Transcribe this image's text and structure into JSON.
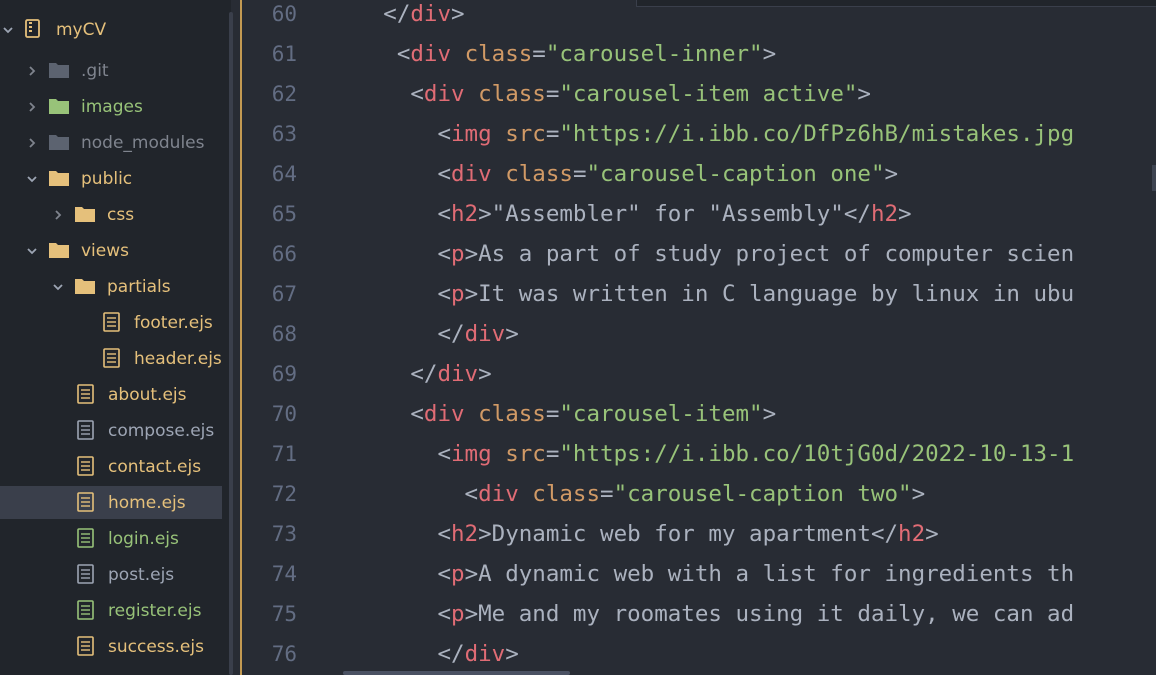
{
  "sidebar": {
    "root": {
      "label": "myCV",
      "icon": "repo-icon"
    },
    "items": [
      {
        "label": ".git",
        "kind": "folder",
        "expanded": false,
        "color": "#7f848e",
        "folder_color": "#5c6370"
      },
      {
        "label": "images",
        "kind": "folder",
        "expanded": false,
        "color": "#98c379",
        "folder_color": "#98c379"
      },
      {
        "label": "node_modules",
        "kind": "folder",
        "expanded": false,
        "color": "#7f848e",
        "folder_color": "#5c6370"
      },
      {
        "label": "public",
        "kind": "folder",
        "expanded": true,
        "color": "#e5c07b",
        "folder_color": "#e5c07b"
      },
      {
        "label": "css",
        "kind": "folder",
        "expanded": false,
        "color": "#e5c07b",
        "folder_color": "#e5c07b"
      },
      {
        "label": "views",
        "kind": "folder",
        "expanded": true,
        "color": "#e5c07b",
        "folder_color": "#e5c07b"
      },
      {
        "label": "partials",
        "kind": "folder",
        "expanded": true,
        "color": "#e5c07b",
        "folder_color": "#e5c07b"
      },
      {
        "label": "footer.ejs",
        "kind": "file",
        "color": "#e5c07b"
      },
      {
        "label": "header.ejs",
        "kind": "file",
        "color": "#e5c07b"
      },
      {
        "label": "about.ejs",
        "kind": "file",
        "color": "#e5c07b"
      },
      {
        "label": "compose.ejs",
        "kind": "file",
        "color": "#9da5b4"
      },
      {
        "label": "contact.ejs",
        "kind": "file",
        "color": "#e5c07b"
      },
      {
        "label": "home.ejs",
        "kind": "file",
        "color": "#e5c07b",
        "selected": true
      },
      {
        "label": "login.ejs",
        "kind": "file",
        "color": "#98c379"
      },
      {
        "label": "post.ejs",
        "kind": "file",
        "color": "#9da5b4"
      },
      {
        "label": "register.ejs",
        "kind": "file",
        "color": "#98c379"
      },
      {
        "label": "success.ejs",
        "kind": "file",
        "color": "#e5c07b"
      }
    ]
  },
  "editor": {
    "colors": {
      "punct": "#abb2bf",
      "tag": "#e06c75",
      "attr": "#d19a66",
      "string": "#98c379",
      "text": "#abb2bf",
      "gutter_modified": "#c39a52"
    },
    "lines": [
      {
        "n": "60",
        "tokens": [
          [
            "p",
            "      </"
          ],
          [
            "tag",
            "div"
          ],
          [
            "p",
            ">"
          ]
        ]
      },
      {
        "n": "61",
        "tokens": [
          [
            "p",
            "       <"
          ],
          [
            "tag",
            "div"
          ],
          [
            "p",
            " "
          ],
          [
            "attr",
            "class"
          ],
          [
            "p",
            "="
          ],
          [
            "str",
            "\"carousel-inner\""
          ],
          [
            "p",
            ">"
          ]
        ]
      },
      {
        "n": "62",
        "tokens": [
          [
            "p",
            "        <"
          ],
          [
            "tag",
            "div"
          ],
          [
            "p",
            " "
          ],
          [
            "attr",
            "class"
          ],
          [
            "p",
            "="
          ],
          [
            "str",
            "\"carousel-item active\""
          ],
          [
            "p",
            ">"
          ]
        ]
      },
      {
        "n": "63",
        "tokens": [
          [
            "p",
            "          <"
          ],
          [
            "tag",
            "img"
          ],
          [
            "p",
            " "
          ],
          [
            "attr",
            "src"
          ],
          [
            "p",
            "="
          ],
          [
            "str",
            "\"https://i.ibb.co/DfPz6hB/mistakes.jpg"
          ]
        ]
      },
      {
        "n": "64",
        "tokens": [
          [
            "p",
            "          <"
          ],
          [
            "tag",
            "div"
          ],
          [
            "p",
            " "
          ],
          [
            "attr",
            "class"
          ],
          [
            "p",
            "="
          ],
          [
            "str",
            "\"carousel-caption one\""
          ],
          [
            "p",
            ">"
          ]
        ]
      },
      {
        "n": "65",
        "tokens": [
          [
            "p",
            "          <"
          ],
          [
            "tag",
            "h2"
          ],
          [
            "p",
            ">"
          ],
          [
            "text",
            "\"Assembler\" for \"Assembly\""
          ],
          [
            "p",
            "</"
          ],
          [
            "tag",
            "h2"
          ],
          [
            "p",
            ">"
          ]
        ]
      },
      {
        "n": "66",
        "tokens": [
          [
            "p",
            "          <"
          ],
          [
            "tag",
            "p"
          ],
          [
            "p",
            ">"
          ],
          [
            "text",
            "As a part of study project of computer scien"
          ]
        ]
      },
      {
        "n": "67",
        "tokens": [
          [
            "p",
            "          <"
          ],
          [
            "tag",
            "p"
          ],
          [
            "p",
            ">"
          ],
          [
            "text",
            "It was written in C language by linux in ubu"
          ]
        ]
      },
      {
        "n": "68",
        "tokens": [
          [
            "p",
            "          </"
          ],
          [
            "tag",
            "div"
          ],
          [
            "p",
            ">"
          ]
        ]
      },
      {
        "n": "69",
        "tokens": [
          [
            "p",
            "        </"
          ],
          [
            "tag",
            "div"
          ],
          [
            "p",
            ">"
          ]
        ]
      },
      {
        "n": "70",
        "tokens": [
          [
            "p",
            "        <"
          ],
          [
            "tag",
            "div"
          ],
          [
            "p",
            " "
          ],
          [
            "attr",
            "class"
          ],
          [
            "p",
            "="
          ],
          [
            "str",
            "\"carousel-item\""
          ],
          [
            "p",
            ">"
          ]
        ]
      },
      {
        "n": "71",
        "tokens": [
          [
            "p",
            "          <"
          ],
          [
            "tag",
            "img"
          ],
          [
            "p",
            " "
          ],
          [
            "attr",
            "src"
          ],
          [
            "p",
            "="
          ],
          [
            "str",
            "\"https://i.ibb.co/10tjG0d/2022-10-13-1"
          ]
        ]
      },
      {
        "n": "72",
        "tokens": [
          [
            "p",
            "            <"
          ],
          [
            "tag",
            "div"
          ],
          [
            "p",
            " "
          ],
          [
            "attr",
            "class"
          ],
          [
            "p",
            "="
          ],
          [
            "str",
            "\"carousel-caption two\""
          ],
          [
            "p",
            ">"
          ]
        ]
      },
      {
        "n": "73",
        "tokens": [
          [
            "p",
            "          <"
          ],
          [
            "tag",
            "h2"
          ],
          [
            "p",
            ">"
          ],
          [
            "text",
            "Dynamic web for my apartment"
          ],
          [
            "p",
            "</"
          ],
          [
            "tag",
            "h2"
          ],
          [
            "p",
            ">"
          ]
        ]
      },
      {
        "n": "74",
        "tokens": [
          [
            "p",
            "          <"
          ],
          [
            "tag",
            "p"
          ],
          [
            "p",
            ">"
          ],
          [
            "text",
            "A dynamic web with a list for ingredients th"
          ]
        ]
      },
      {
        "n": "75",
        "tokens": [
          [
            "p",
            "          <"
          ],
          [
            "tag",
            "p"
          ],
          [
            "p",
            ">"
          ],
          [
            "text",
            "Me and my roomates using it daily, we can ad"
          ]
        ]
      },
      {
        "n": "76",
        "tokens": [
          [
            "p",
            "          </"
          ],
          [
            "tag",
            "div"
          ],
          [
            "p",
            ">"
          ]
        ]
      }
    ]
  }
}
